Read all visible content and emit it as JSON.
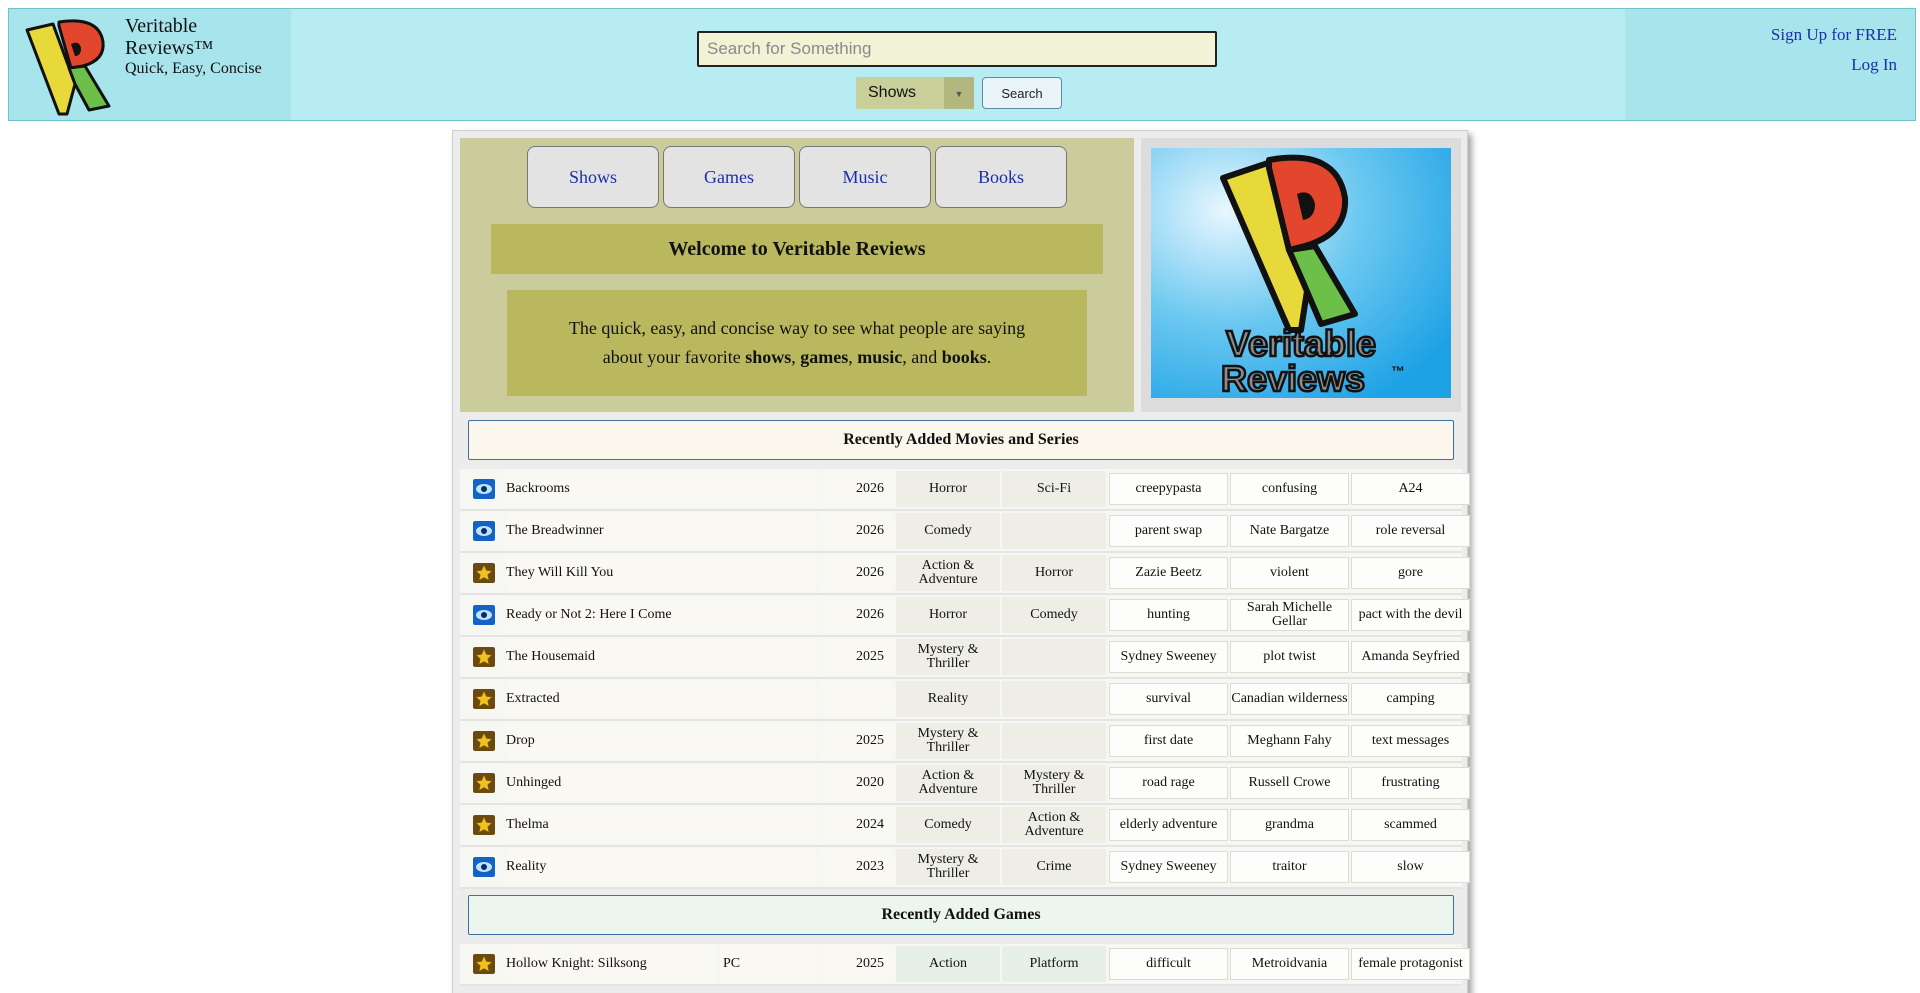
{
  "header": {
    "brand_name": "Veritable Reviews™",
    "tagline": "Quick, Easy, Concise",
    "search_placeholder": "Search for Something",
    "search_value": "",
    "category_selected": "Shows",
    "search_button": "Search",
    "signup_link": "Sign Up for FREE",
    "login_link": "Log In"
  },
  "nav_tabs": [
    "Shows",
    "Games",
    "Music",
    "Books"
  ],
  "hero": {
    "welcome_title": "Welcome to Veritable Reviews",
    "intro_text_1": "The quick, easy, and concise way to see what people are saying about your favorite",
    "intro_shows": "shows",
    "intro_games": "games",
    "intro_music": "music",
    "intro_books": "books",
    "image_text_line1": "Veritable",
    "image_text_line2": "Reviews",
    "image_tm": "™"
  },
  "movies_section": {
    "title": "Recently Added Movies and Series",
    "rows": [
      {
        "icon": "blue-eye-icon",
        "title": "Backrooms",
        "year": "2026",
        "genre1": "Horror",
        "genre2": "Sci-Fi",
        "tags": [
          "creepypasta",
          "confusing",
          "A24"
        ]
      },
      {
        "icon": "blue-eye-icon",
        "title": "The Breadwinner",
        "year": "2026",
        "genre1": "Comedy",
        "genre2": "",
        "tags": [
          "parent swap",
          "Nate Bargatze",
          "role reversal"
        ]
      },
      {
        "icon": "gold-star-icon",
        "title": "They Will Kill You",
        "year": "2026",
        "genre1": "Action & Adventure",
        "genre2": "Horror",
        "tags": [
          "Zazie Beetz",
          "violent",
          "gore"
        ]
      },
      {
        "icon": "blue-eye-icon",
        "title": "Ready or Not 2: Here I Come",
        "year": "2026",
        "genre1": "Horror",
        "genre2": "Comedy",
        "tags": [
          "hunting",
          "Sarah Michelle Gellar",
          "pact with the devil"
        ]
      },
      {
        "icon": "gold-star-icon",
        "title": "The Housemaid",
        "year": "2025",
        "genre1": "Mystery & Thriller",
        "genre2": "",
        "tags": [
          "Sydney Sweeney",
          "plot twist",
          "Amanda Seyfried"
        ]
      },
      {
        "icon": "gold-star-icon",
        "title": "Extracted",
        "year": "",
        "genre1": "Reality",
        "genre2": "",
        "tags": [
          "survival",
          "Canadian wilderness",
          "camping"
        ]
      },
      {
        "icon": "gold-star-icon",
        "title": "Drop",
        "year": "2025",
        "genre1": "Mystery & Thriller",
        "genre2": "",
        "tags": [
          "first date",
          "Meghann Fahy",
          "text messages"
        ]
      },
      {
        "icon": "gold-star-icon",
        "title": "Unhinged",
        "year": "2020",
        "genre1": "Action & Adventure",
        "genre2": "Mystery & Thriller",
        "tags": [
          "road rage",
          "Russell Crowe",
          "frustrating"
        ]
      },
      {
        "icon": "gold-star-icon",
        "title": "Thelma",
        "year": "2024",
        "genre1": "Comedy",
        "genre2": "Action & Adventure",
        "tags": [
          "elderly adventure",
          "grandma",
          "scammed"
        ]
      },
      {
        "icon": "blue-eye-icon",
        "title": "Reality",
        "year": "2023",
        "genre1": "Mystery & Thriller",
        "genre2": "Crime",
        "tags": [
          "Sydney Sweeney",
          "traitor",
          "slow"
        ]
      }
    ]
  },
  "games_section": {
    "title": "Recently Added Games",
    "rows": [
      {
        "icon": "gold-star-icon",
        "title": "Hollow Knight: Silksong",
        "platform": "PC",
        "year": "2025",
        "genre1": "Action",
        "genre2": "Platform",
        "tags": [
          "difficult",
          "Metroidvania",
          "female protagonist"
        ]
      }
    ]
  },
  "colors": {
    "header_bg": "#b6ecf2",
    "hero_bg": "#cbcc9c",
    "welcome_bg": "#b9b85e",
    "link": "#1a2fa8",
    "logo_yellow": "#e8d93a",
    "logo_red": "#e2472d",
    "logo_green": "#6cc04a"
  }
}
